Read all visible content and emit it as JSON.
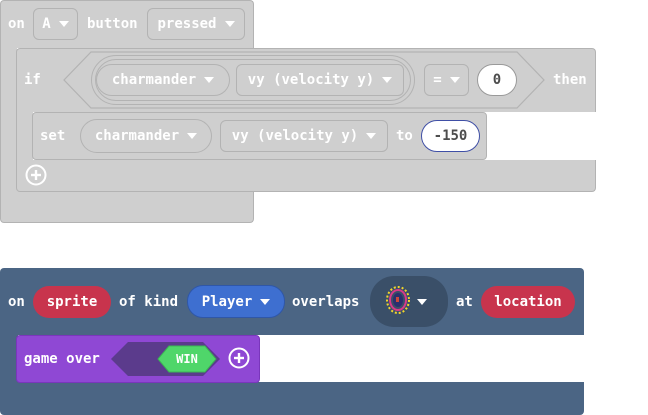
{
  "event1": {
    "on": "on",
    "key": "A",
    "button": "button",
    "state": "pressed",
    "if_block": {
      "if": "if",
      "sprite": "charmander",
      "property": "vy (velocity y)",
      "operator": "=",
      "value": "0",
      "then": "then"
    },
    "set_block": {
      "set": "set",
      "sprite": "charmander",
      "property": "vy (velocity y)",
      "to": "to",
      "value": "-150"
    },
    "colors": {
      "block": "#cfcfcf",
      "border": "#b3b3b3"
    }
  },
  "event2": {
    "on": "on",
    "sprite": "sprite",
    "of_kind": "of kind",
    "kind": "Player",
    "overlaps": "overlaps",
    "image_icon": "sprite-image-icon",
    "at": "at",
    "location": "location",
    "game_over": {
      "label": "game over",
      "value": "WIN"
    },
    "colors": {
      "block": "#4b6584",
      "sprite_pill": "#c8344d",
      "kind_pill": "#3e6fd0",
      "game_over": "#8f48d4",
      "win": "#4fd66a"
    }
  }
}
